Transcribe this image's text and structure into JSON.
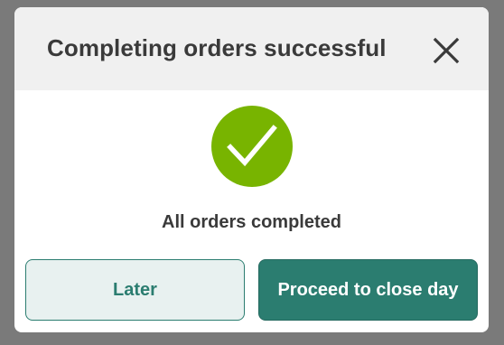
{
  "dialog": {
    "title": "Completing orders successful",
    "close_icon": "close-icon",
    "status_icon": "checkmark-circle-icon",
    "status_message": "All orders completed",
    "buttons": {
      "later_label": "Later",
      "proceed_label": "Proceed to close day"
    }
  },
  "colors": {
    "overlay": "#7a7a7a",
    "header_bg": "#f0f0f0",
    "success_green": "#78b400",
    "primary_teal": "#2b7d70",
    "secondary_bg": "#e8f1f0",
    "text_dark": "#3a3a3a"
  }
}
